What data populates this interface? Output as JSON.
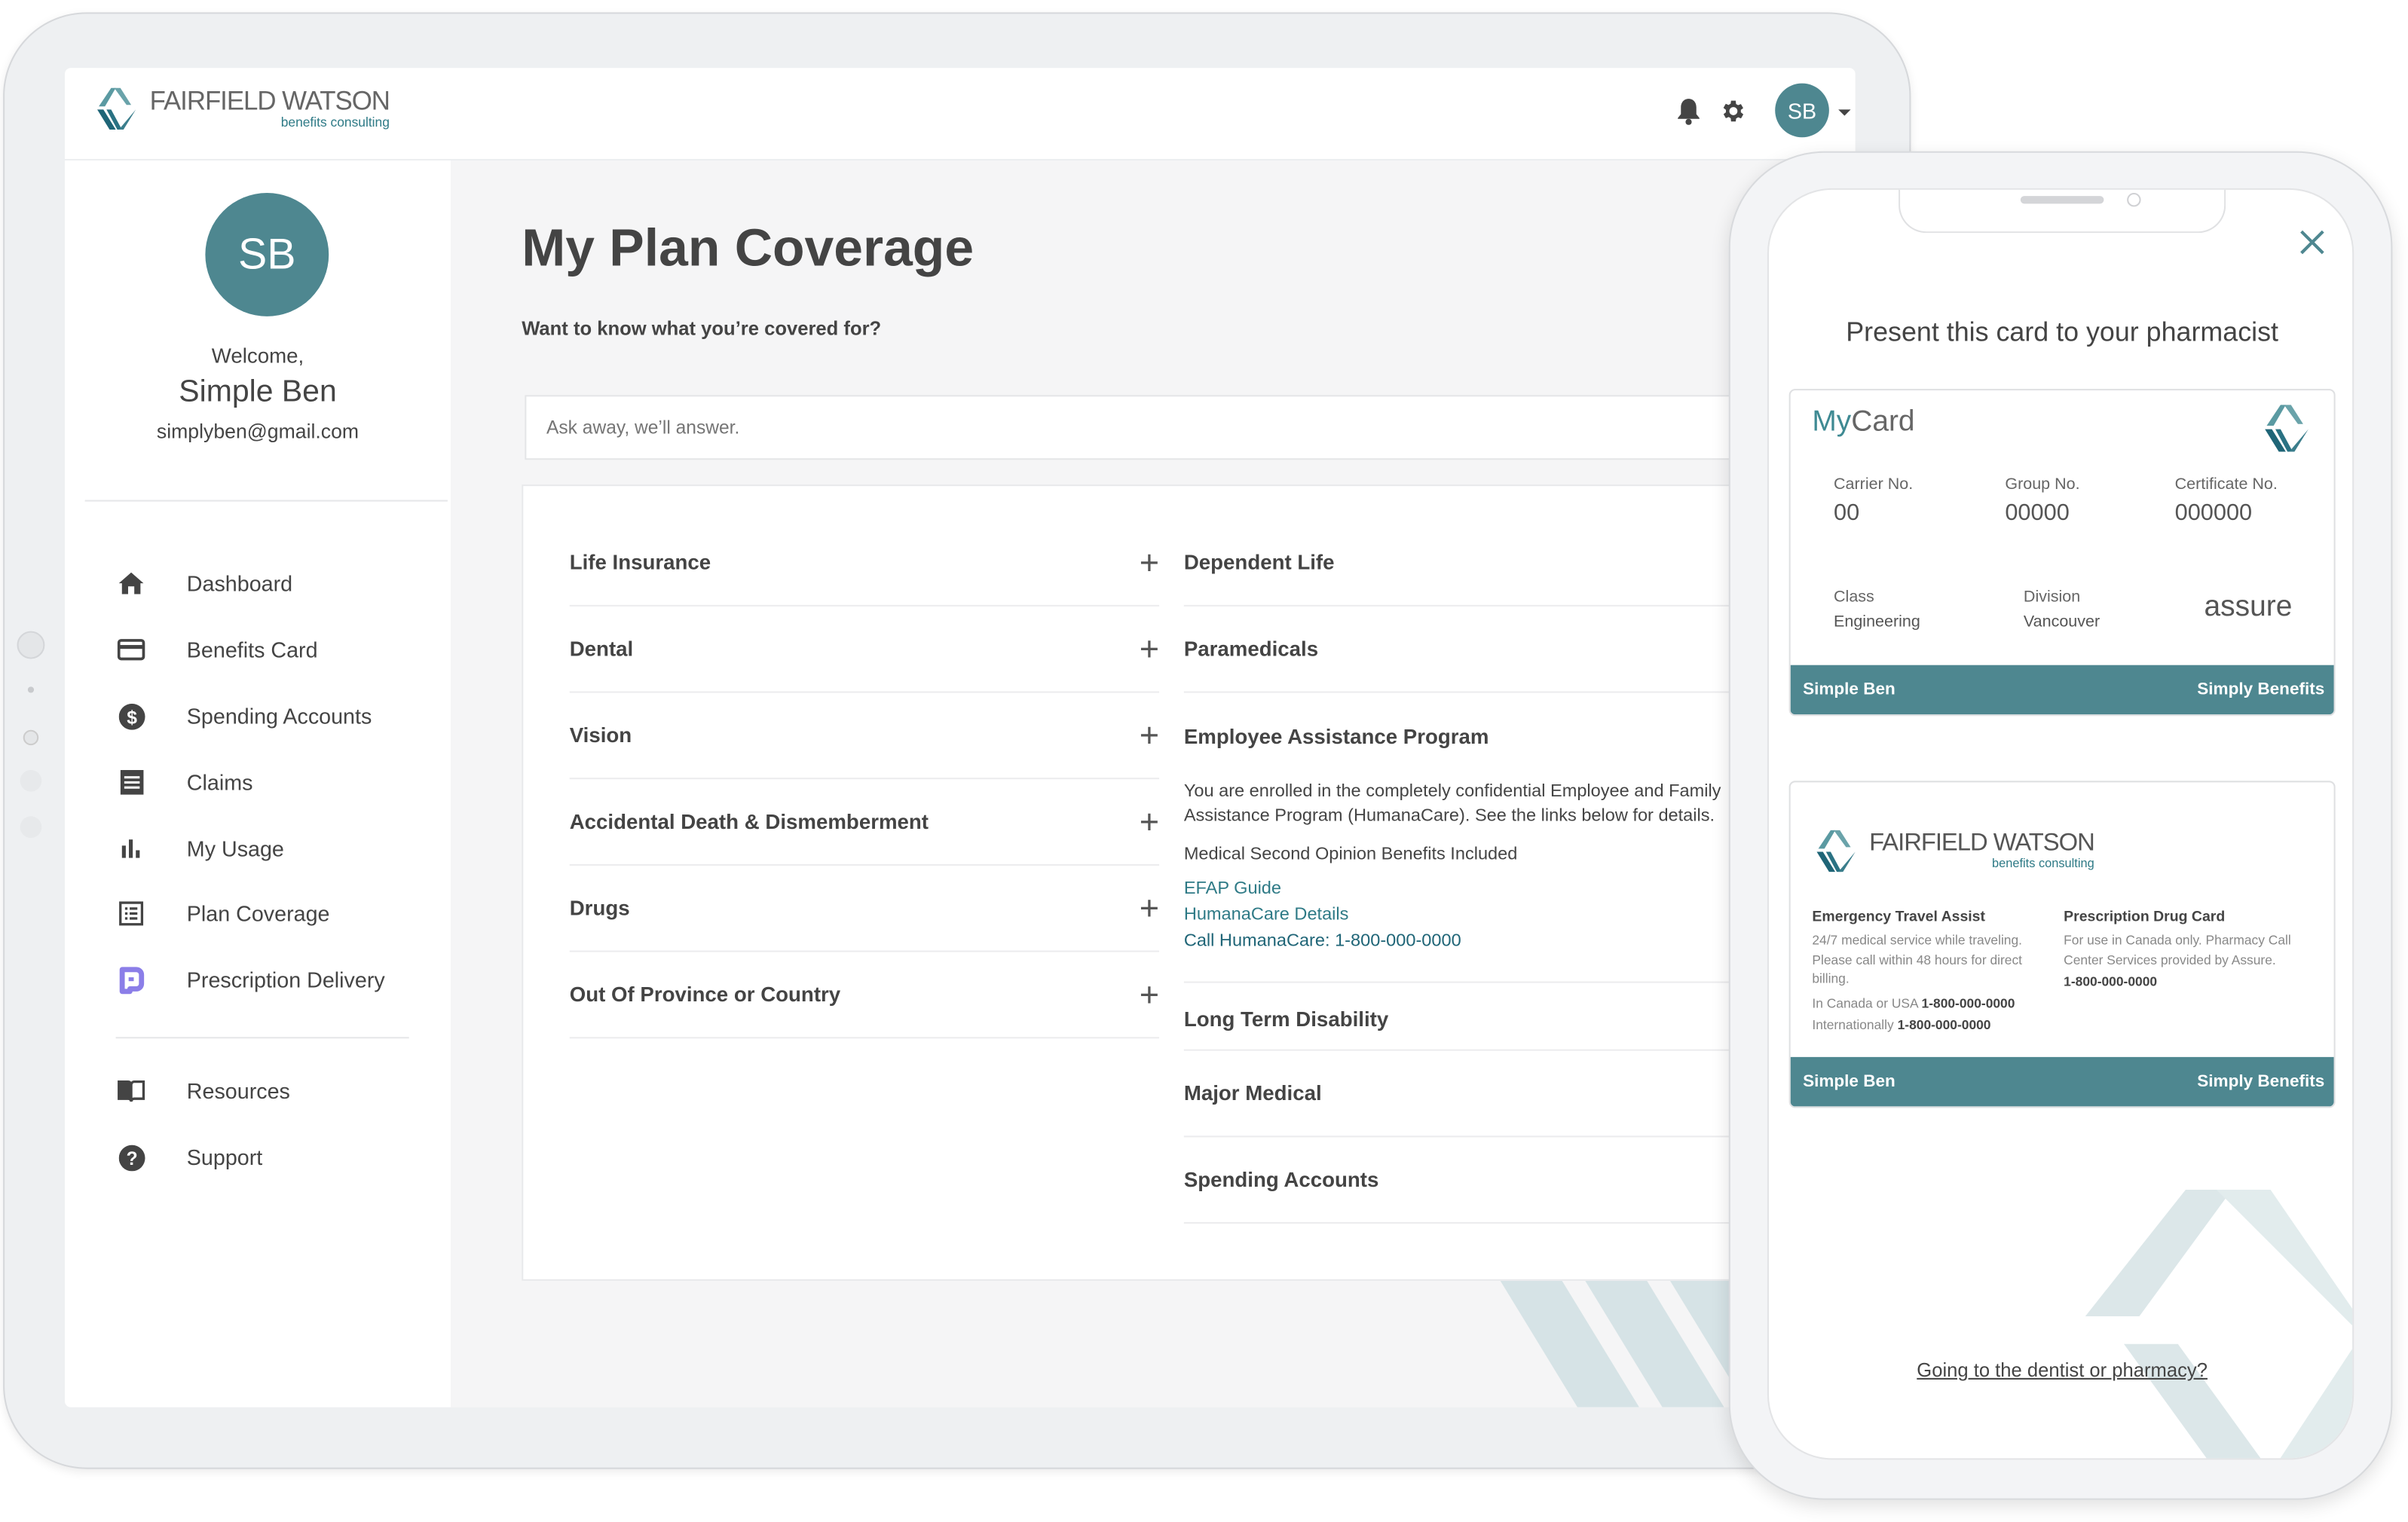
{
  "brand": {
    "name": "FAIRFIELD WATSON",
    "tagline": "benefits consulting",
    "accent": "#4e8790",
    "link_color": "#2e7a86",
    "prescription_icon_color": "#8b7ee8"
  },
  "header": {
    "user_initials": "SB",
    "icons": [
      "bell-icon",
      "gear-icon",
      "caret-down-icon"
    ]
  },
  "sidebar": {
    "initials": "SB",
    "welcome": "Welcome,",
    "name": "Simple Ben",
    "email": "simplyben@gmail.com",
    "items": [
      {
        "label": "Dashboard",
        "icon": "home-icon"
      },
      {
        "label": "Benefits Card",
        "icon": "credit-card-icon"
      },
      {
        "label": "Spending Accounts",
        "icon": "dollar-circle-icon"
      },
      {
        "label": "Claims",
        "icon": "receipt-icon"
      },
      {
        "label": "My Usage",
        "icon": "bar-chart-icon"
      },
      {
        "label": "Plan Coverage",
        "icon": "list-icon"
      },
      {
        "label": "Prescription Delivery",
        "icon": "prescription-icon"
      }
    ],
    "secondary": [
      {
        "label": "Resources",
        "icon": "book-icon"
      },
      {
        "label": "Support",
        "icon": "help-circle-icon"
      }
    ]
  },
  "main": {
    "title": "My Plan Coverage",
    "subtitle": "Want to know what you’re covered for?",
    "search_placeholder": "Ask away, we’ll answer.",
    "left_items": [
      "Life Insurance",
      "Dental",
      "Vision",
      "Accidental Death & Dismemberment",
      "Drugs",
      "Out Of Province or Country"
    ],
    "right_items": [
      "Dependent Life",
      "Paramedicals",
      "Employee Assistance Program"
    ],
    "eap": {
      "description": "You are enrolled in the completely confidential Employee and Family Assistance Program (HumanaCare). See the links below for details.",
      "note": "Medical Second Opinion Benefits Included",
      "links": [
        "EFAP Guide",
        "HumanaCare Details",
        "Call HumanaCare: 1-800-000-0000"
      ]
    },
    "right_items_after": [
      "Long Term Disability",
      "Major Medical",
      "Spending Accounts"
    ]
  },
  "phone": {
    "heading": "Present this card to your pharmacist",
    "card_front": {
      "title_my": "My",
      "title_card": "Card",
      "fields": [
        {
          "label": "Carrier No.",
          "value": "00"
        },
        {
          "label": "Group No.",
          "value": "00000"
        },
        {
          "label": "Certificate No.",
          "value": "000000"
        }
      ],
      "class_label": "Class",
      "class_value": "Engineering",
      "division_label": "Division",
      "division_value": "Vancouver",
      "carrier_logo": "assure",
      "holder": "Simple Ben",
      "plan": "Simply Benefits"
    },
    "card_back": {
      "brand": "FAIRFIELD WATSON",
      "tagline": "benefits consulting",
      "travel_title": "Emergency Travel Assist",
      "travel_text": "24/7 medical service while traveling. Please call within 48 hours for direct billing.",
      "canada_label": "In Canada or USA",
      "canada_phone": "1-800-000-0000",
      "intl_label": "Internationally",
      "intl_phone": "1-800-000-0000",
      "drug_title": "Prescription Drug Card",
      "drug_text": "For use in Canada only. Pharmacy Call Center Services provided by Assure.",
      "drug_phone": "1-800-000-0000",
      "holder": "Simple Ben",
      "plan": "Simply Benefits"
    },
    "footer_link": "Going to the dentist or pharmacy?"
  }
}
